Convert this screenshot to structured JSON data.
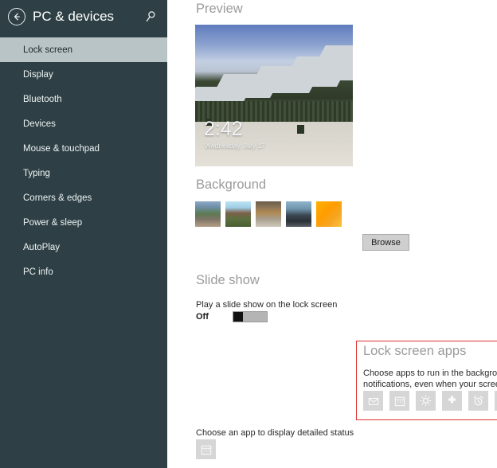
{
  "sidebar": {
    "back_label": "‹",
    "title": "PC & devices",
    "search_icon": "search-icon",
    "items": [
      {
        "label": "Lock screen",
        "selected": true
      },
      {
        "label": "Display",
        "selected": false
      },
      {
        "label": "Bluetooth",
        "selected": false
      },
      {
        "label": "Devices",
        "selected": false
      },
      {
        "label": "Mouse & touchpad",
        "selected": false
      },
      {
        "label": "Typing",
        "selected": false
      },
      {
        "label": "Corners & edges",
        "selected": false
      },
      {
        "label": "Power & sleep",
        "selected": false
      },
      {
        "label": "AutoPlay",
        "selected": false
      },
      {
        "label": "PC info",
        "selected": false
      }
    ]
  },
  "preview": {
    "heading": "Preview",
    "time": "2:42",
    "date": "Wednesday, July 17"
  },
  "background": {
    "heading": "Background",
    "thumbnails": [
      {
        "name": "thumbnail-village-mountains"
      },
      {
        "name": "thumbnail-mountain-landscape"
      },
      {
        "name": "thumbnail-street-market"
      },
      {
        "name": "thumbnail-coastal-vehicle"
      },
      {
        "name": "thumbnail-orange-abstract"
      }
    ],
    "browse_label": "Browse"
  },
  "slide_show": {
    "heading": "Slide show",
    "description": "Play a slide show on the lock screen",
    "toggle_state": "Off"
  },
  "lock_screen_apps": {
    "heading": "Lock screen apps",
    "description": "Choose apps to run in the background and show quick status and notifications, even when your screen is locked",
    "highlight_color": "#e03030",
    "apps": [
      {
        "name": "mail-icon",
        "glyph": "✉"
      },
      {
        "name": "calendar-icon",
        "glyph": "Ὄ5"
      },
      {
        "name": "weather-icon",
        "glyph": "☀"
      },
      {
        "name": "health-icon",
        "glyph": "✚"
      },
      {
        "name": "alarm-icon",
        "glyph": "⏰"
      },
      {
        "name": "add-app-icon-1",
        "glyph": "+"
      },
      {
        "name": "add-app-icon-2",
        "glyph": "+"
      }
    ]
  },
  "detailed_status": {
    "label": "Choose an app to display detailed status",
    "app": {
      "name": "calendar-icon",
      "glyph": "Ὄ5"
    }
  }
}
